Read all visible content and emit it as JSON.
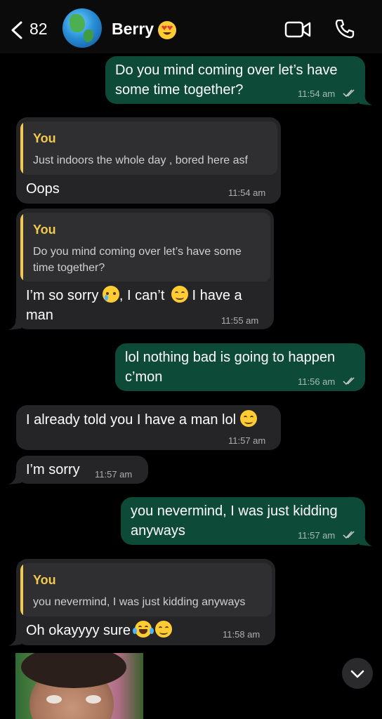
{
  "header": {
    "back_count": "82",
    "contact_name": "Berry",
    "name_emoji": "heart-eyes-emoji",
    "avatar": "globe-avatar",
    "icons": {
      "back": "chevron-left-icon",
      "video": "video-call-icon",
      "phone": "phone-call-icon"
    }
  },
  "messages": [
    {
      "dir": "out",
      "text_lines": [
        "Do you mind coming over let’s have",
        "some time together?"
      ],
      "time": "11:54 am",
      "status": "read"
    },
    {
      "dir": "in",
      "quote": {
        "author": "You",
        "text_lines": [
          "Just indoors the whole day , bored here asf"
        ]
      },
      "text": "Oops",
      "time": "11:54 am"
    },
    {
      "dir": "in",
      "quote": {
        "author": "You",
        "text_lines": [
          "Do you mind coming over let’s have some",
          "time together?"
        ]
      },
      "text_parts": [
        "I’m so sorry",
        ", I can’t",
        "I have a",
        "man"
      ],
      "time": "11:55 am"
    },
    {
      "dir": "out",
      "text_lines": [
        "lol nothing bad is going to happen",
        "c’mon"
      ],
      "time": "11:56 am",
      "status": "read"
    },
    {
      "dir": "in",
      "text": "I already told you I have a man lol",
      "time": "11:57 am"
    },
    {
      "dir": "in",
      "text": "I’m sorry",
      "time": "11:57 am"
    },
    {
      "dir": "out",
      "text_lines": [
        "you nevermind, I was just kidding",
        "anyways"
      ],
      "time": "11:57 am",
      "status": "read"
    },
    {
      "dir": "in",
      "quote": {
        "author": "You",
        "text_lines": [
          "you nevermind, I was just kidding anyways"
        ]
      },
      "text": "Oh okayyyy sure",
      "time": "11:58 am"
    }
  ],
  "colors": {
    "outgoing_bubble": "#0e4a38",
    "incoming_bubble": "#252527",
    "quote_accent": "#f2c94c",
    "background": "#000000"
  },
  "scroll_button_icon": "chevron-down-icon"
}
